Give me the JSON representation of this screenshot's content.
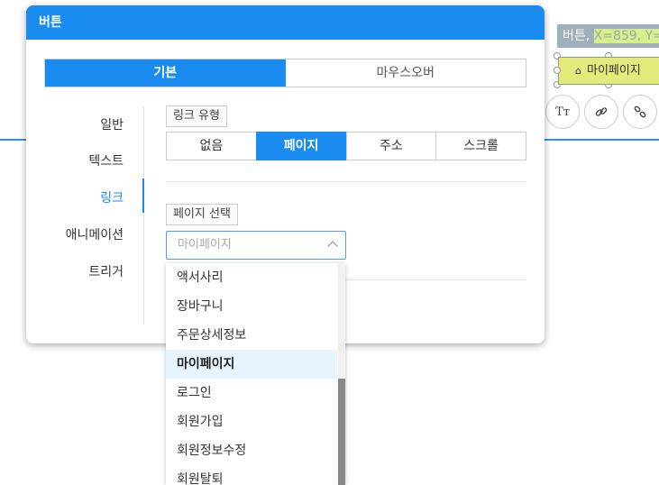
{
  "canvas": {
    "coord_label_prefix": "버튼, ",
    "coord_label_value": "X=859, Y=",
    "selected_button_label": "마이페이지",
    "tools": [
      "text-style-icon",
      "link-icon",
      "unlink-icon"
    ],
    "accent_color": "#1a8cf0"
  },
  "modal": {
    "title": "버튼",
    "main_tabs": [
      {
        "label": "기본",
        "active": true
      },
      {
        "label": "마우스오버",
        "active": false
      }
    ],
    "side_nav": [
      {
        "label": "일반",
        "active": false
      },
      {
        "label": "텍스트",
        "active": false
      },
      {
        "label": "링크",
        "active": true
      },
      {
        "label": "애니메이션",
        "active": false
      },
      {
        "label": "트리거",
        "active": false
      }
    ],
    "link_type_label": "링크 유형",
    "link_types": [
      {
        "label": "없음",
        "active": false
      },
      {
        "label": "페이지",
        "active": true
      },
      {
        "label": "주소",
        "active": false
      },
      {
        "label": "스크롤",
        "active": false
      }
    ],
    "page_select_label": "페이지 선택",
    "page_select_value": "마이페이지"
  },
  "dropdown": {
    "options": [
      "액서사리",
      "장바구니",
      "주문상세정보",
      "마이페이지",
      "로그인",
      "회원가입",
      "회원정보수정",
      "회원탈퇴"
    ],
    "selected_index": 3
  }
}
